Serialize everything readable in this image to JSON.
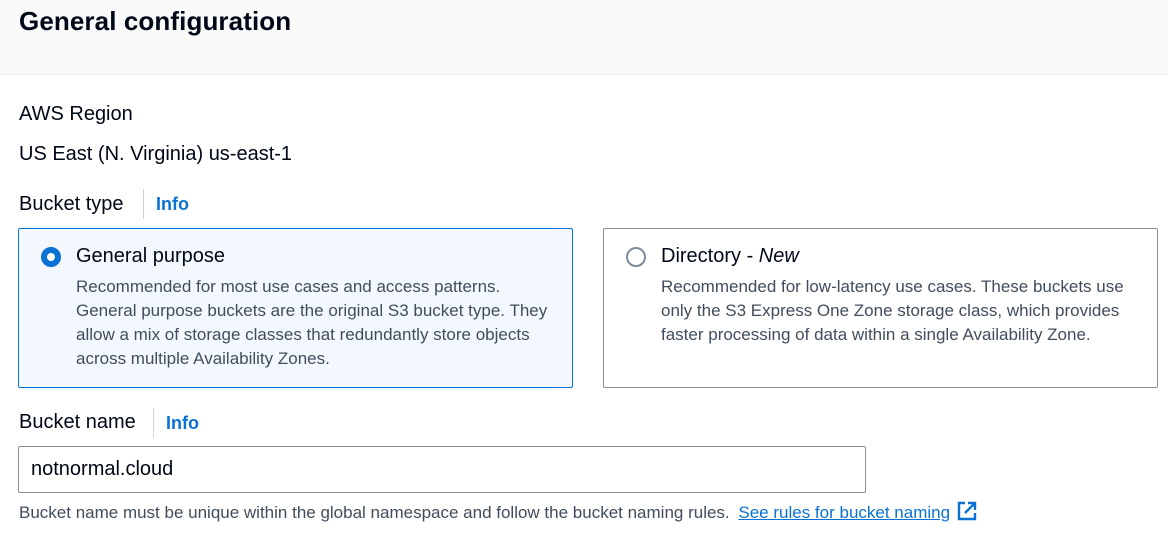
{
  "header": {
    "title": "General configuration"
  },
  "region": {
    "label": "AWS Region",
    "value": "US East (N. Virginia) us-east-1"
  },
  "bucket_type": {
    "label": "Bucket type",
    "info": "Info",
    "options": [
      {
        "title": "General purpose",
        "title_suffix": "",
        "selected": true,
        "description": "Recommended for most use cases and access patterns. General purpose buckets are the original S3 bucket type. They allow a mix of storage classes that redundantly store objects across multiple Availability Zones."
      },
      {
        "title": "Directory - ",
        "title_suffix": "New",
        "selected": false,
        "description": "Recommended for low-latency use cases. These buckets use only the S3 Express One Zone storage class, which provides faster processing of data within a single Availability Zone."
      }
    ]
  },
  "bucket_name": {
    "label": "Bucket name",
    "info": "Info",
    "value": "notnormal.cloud",
    "help_text": "Bucket name must be unique within the global namespace and follow the bucket naming rules.",
    "link_text": "See rules for bucket naming",
    "link_icon": "external-link-icon"
  },
  "colors": {
    "accent": "#0972d3",
    "selected_bg": "#f2f8fd",
    "text": "#000716",
    "secondary_text": "#414d5c"
  }
}
